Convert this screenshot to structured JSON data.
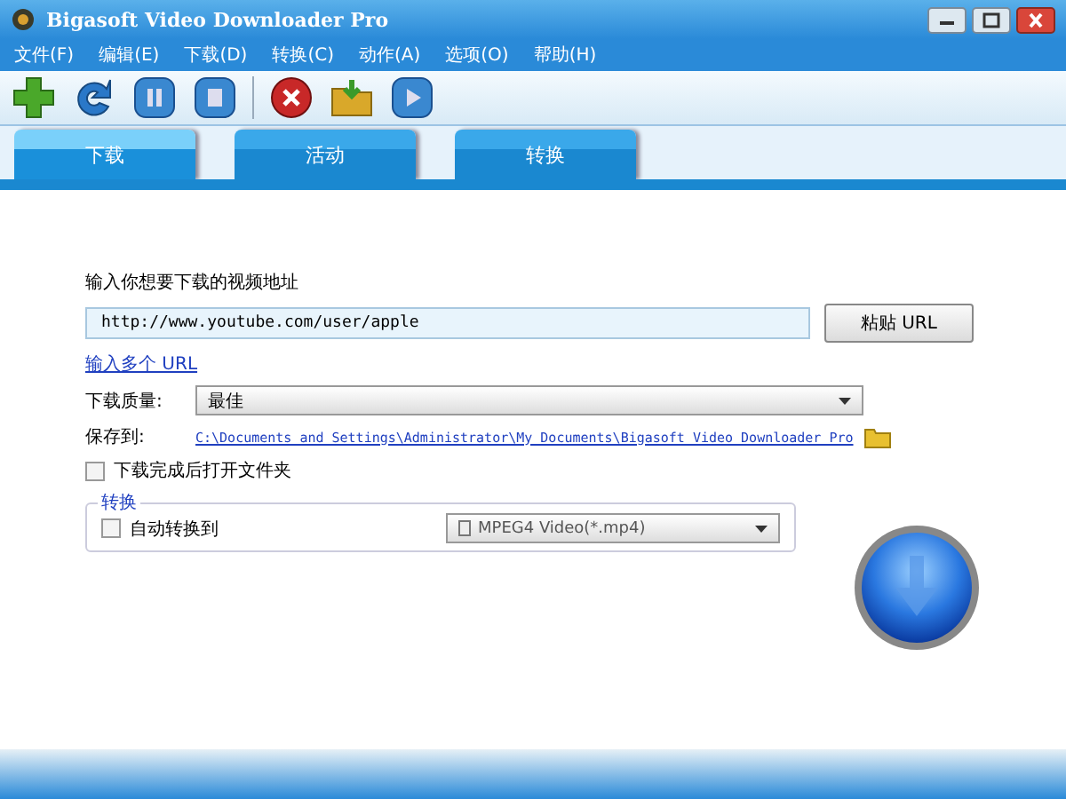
{
  "window": {
    "title": "Bigasoft Video Downloader Pro"
  },
  "menu": [
    "文件(F)",
    "编辑(E)",
    "下载(D)",
    "转换(C)",
    "动作(A)",
    "选项(O)",
    "帮助(H)"
  ],
  "toolbar": [
    {
      "kind": "add"
    },
    {
      "kind": "refresh"
    },
    {
      "kind": "pause"
    },
    {
      "kind": "stop"
    },
    {
      "kind": "delete"
    },
    {
      "kind": "folder"
    },
    {
      "kind": "play"
    }
  ],
  "tabs": [
    {
      "label": "下载",
      "selected": true
    },
    {
      "label": "活动",
      "selected": false
    },
    {
      "label": "转换",
      "selected": false
    }
  ],
  "url_label": "输入你想要下载的视频地址",
  "url_value": "http://www.youtube.com/user/apple",
  "paste_button": "粘贴 URL",
  "multi_url_link": "输入多个 URL",
  "quality_label": "下载质量:",
  "quality_value": "最佳",
  "save_label": "保存到:",
  "save_path": "C:\\Documents and Settings\\Administrator\\My Documents\\Bigasoft Video Downloader Pro",
  "open_folder": {
    "label": "下载完成后打开文件夹",
    "checked": false
  },
  "convert_group": {
    "title": "转换",
    "auto_convert": {
      "label": "自动转换到",
      "checked": false
    },
    "format": "MPEG4 Video(*.mp4)"
  }
}
